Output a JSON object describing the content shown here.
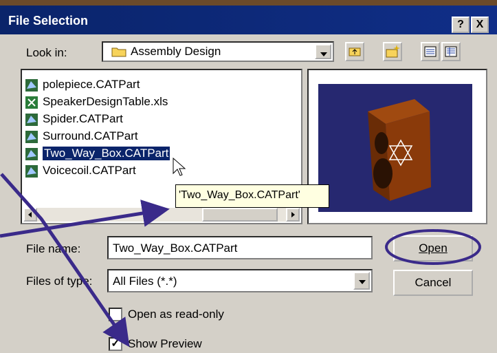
{
  "window": {
    "title": "File Selection",
    "help_label": "?",
    "close_label": "X"
  },
  "lookin": {
    "label": "Look in:",
    "folder": "Assembly Design"
  },
  "files": [
    {
      "name": "polepiece.CATPart",
      "icon": "catpart-icon"
    },
    {
      "name": "SpeakerDesignTable.xls",
      "icon": "excel-icon"
    },
    {
      "name": "Spider.CATPart",
      "icon": "catpart-icon"
    },
    {
      "name": "Surround.CATPart",
      "icon": "catpart-icon"
    },
    {
      "name": "Two_Way_Box.CATPart",
      "icon": "catpart-icon",
      "selected": true
    },
    {
      "name": "Voicecoil.CATPart",
      "icon": "catpart-icon"
    }
  ],
  "tooltip": "'Two_Way_Box.CATPart'",
  "filename": {
    "label": "File name:",
    "value": "Two_Way_Box.CATPart"
  },
  "filetype": {
    "label": "Files of type:",
    "value": "All Files (*.*)"
  },
  "buttons": {
    "open": "Open",
    "cancel": "Cancel"
  },
  "checkboxes": {
    "readonly": "Open as read-only",
    "readonly_checked": false,
    "preview": "Show Preview",
    "preview_checked": true,
    "check_mark": "✓"
  },
  "colors": {
    "annotation": "#3a2a8a",
    "titlebar": "#0a246a",
    "selection": "#0a246a"
  }
}
